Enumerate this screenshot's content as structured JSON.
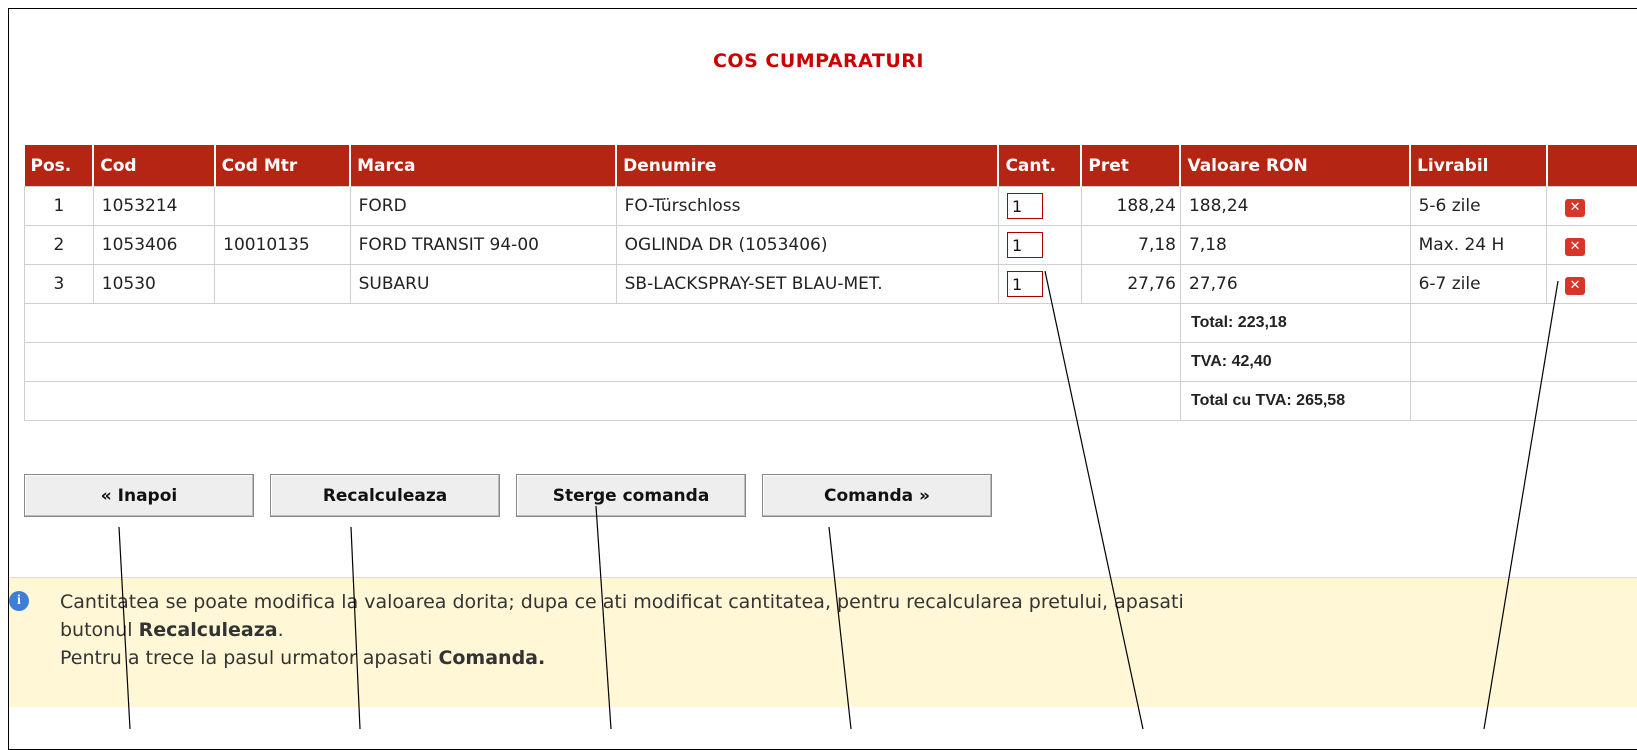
{
  "title": "COS CUMPARATURI",
  "table": {
    "headers": [
      "Pos.",
      "Cod",
      "Cod Mtr",
      "Marca",
      "Denumire",
      "Cant.",
      "Pret",
      "Valoare RON",
      "Livrabil",
      ""
    ],
    "rows": [
      {
        "pos": "1",
        "cod": "1053214",
        "cod_mtr": "",
        "marca": "FORD",
        "denumire": "FO-Türschloss",
        "cant": "1",
        "pret": "188,24",
        "valoare": "188,24",
        "livrabil": "5-6 zile"
      },
      {
        "pos": "2",
        "cod": "1053406",
        "cod_mtr": "10010135",
        "marca": "FORD TRANSIT 94-00",
        "denumire": "OGLINDA DR (1053406)",
        "cant": "1",
        "pret": "7,18",
        "valoare": "7,18",
        "livrabil": "Max. 24 H"
      },
      {
        "pos": "3",
        "cod": "10530",
        "cod_mtr": "",
        "marca": "SUBARU",
        "denumire": "SB-LACKSPRAY-SET BLAU-MET.",
        "cant": "1",
        "pret": "27,76",
        "valoare": "27,76",
        "livrabil": "6-7 zile"
      }
    ],
    "totals": {
      "total": "Total: 223,18",
      "tva": "TVA: 42,40",
      "total_cu_tva": "Total cu TVA: 265,58"
    },
    "delete_icon": "close-icon",
    "delete_glyph": "✕"
  },
  "buttons": {
    "back": "« Inapoi",
    "recalculate": "Recalculeaza",
    "delete_order": "Sterge comanda",
    "order": "Comanda »"
  },
  "info": {
    "icon": "info-icon",
    "icon_glyph": "i",
    "line1": "Cantitatea se poate modifica la valoarea dorita; dupa ce ati modificat cantitatea, pentru recalcularea pretului, apasati",
    "line2_prefix": "butonul ",
    "line2_bold": "Recalculeaza",
    "line2_suffix": ".",
    "line3_prefix": "Pentru a trece la pasul urmator apasati ",
    "line3_bold": "Comanda."
  },
  "colors": {
    "header_bg": "#b52513",
    "title": "#cc0000",
    "info_bg": "#fff7d6"
  }
}
